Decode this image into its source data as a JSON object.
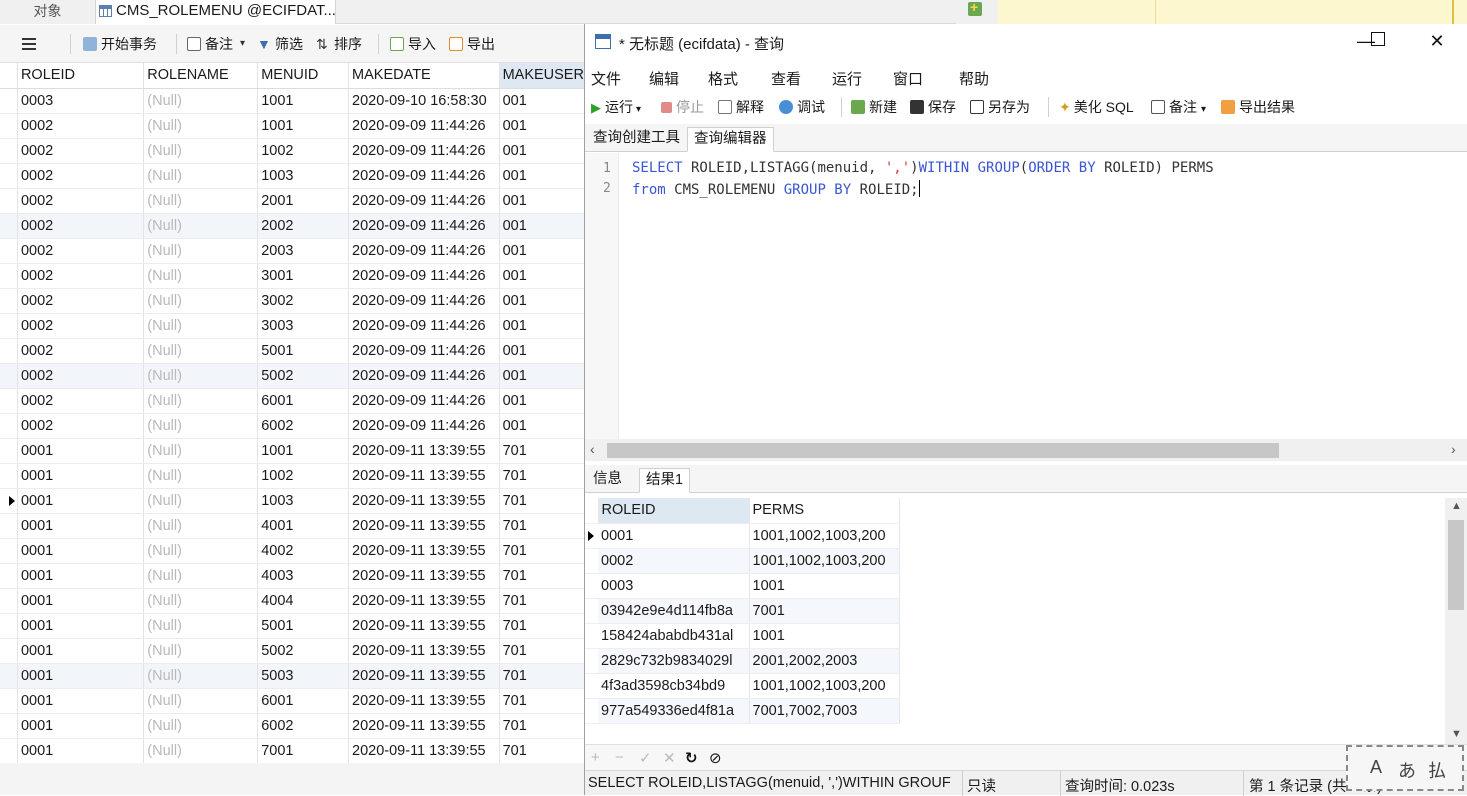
{
  "tabs": {
    "objects": "对象",
    "table_tab": "CMS_ROLEMENU @ECIFDAT..."
  },
  "left_toolbar": {
    "begin_tx": "开始事务",
    "note": "备注",
    "filter": "筛选",
    "sort": "排序",
    "import": "导入",
    "export": "导出"
  },
  "grid": {
    "columns": [
      "ROLEID",
      "ROLENAME",
      "MENUID",
      "MAKEDATE",
      "MAKEUSER"
    ],
    "rows": [
      [
        "0003",
        "(Null)",
        "1001",
        "2020-09-10 16:58:30",
        "001"
      ],
      [
        "0002",
        "(Null)",
        "1001",
        "2020-09-09 11:44:26",
        "001"
      ],
      [
        "0002",
        "(Null)",
        "1002",
        "2020-09-09 11:44:26",
        "001"
      ],
      [
        "0002",
        "(Null)",
        "1003",
        "2020-09-09 11:44:26",
        "001"
      ],
      [
        "0002",
        "(Null)",
        "2001",
        "2020-09-09 11:44:26",
        "001"
      ],
      [
        "0002",
        "(Null)",
        "2002",
        "2020-09-09 11:44:26",
        "001"
      ],
      [
        "0002",
        "(Null)",
        "2003",
        "2020-09-09 11:44:26",
        "001"
      ],
      [
        "0002",
        "(Null)",
        "3001",
        "2020-09-09 11:44:26",
        "001"
      ],
      [
        "0002",
        "(Null)",
        "3002",
        "2020-09-09 11:44:26",
        "001"
      ],
      [
        "0002",
        "(Null)",
        "3003",
        "2020-09-09 11:44:26",
        "001"
      ],
      [
        "0002",
        "(Null)",
        "5001",
        "2020-09-09 11:44:26",
        "001"
      ],
      [
        "0002",
        "(Null)",
        "5002",
        "2020-09-09 11:44:26",
        "001"
      ],
      [
        "0002",
        "(Null)",
        "6001",
        "2020-09-09 11:44:26",
        "001"
      ],
      [
        "0002",
        "(Null)",
        "6002",
        "2020-09-09 11:44:26",
        "001"
      ],
      [
        "0001",
        "(Null)",
        "1001",
        "2020-09-11 13:39:55",
        "701"
      ],
      [
        "0001",
        "(Null)",
        "1002",
        "2020-09-11 13:39:55",
        "701"
      ],
      [
        "0001",
        "(Null)",
        "1003",
        "2020-09-11 13:39:55",
        "701"
      ],
      [
        "0001",
        "(Null)",
        "4001",
        "2020-09-11 13:39:55",
        "701"
      ],
      [
        "0001",
        "(Null)",
        "4002",
        "2020-09-11 13:39:55",
        "701"
      ],
      [
        "0001",
        "(Null)",
        "4003",
        "2020-09-11 13:39:55",
        "701"
      ],
      [
        "0001",
        "(Null)",
        "4004",
        "2020-09-11 13:39:55",
        "701"
      ],
      [
        "0001",
        "(Null)",
        "5001",
        "2020-09-11 13:39:55",
        "701"
      ],
      [
        "0001",
        "(Null)",
        "5002",
        "2020-09-11 13:39:55",
        "701"
      ],
      [
        "0001",
        "(Null)",
        "5003",
        "2020-09-11 13:39:55",
        "701"
      ],
      [
        "0001",
        "(Null)",
        "6001",
        "2020-09-11 13:39:55",
        "701"
      ],
      [
        "0001",
        "(Null)",
        "6002",
        "2020-09-11 13:39:55",
        "701"
      ],
      [
        "0001",
        "(Null)",
        "7001",
        "2020-09-11 13:39:55",
        "701"
      ]
    ],
    "current_row": 16,
    "alt_rows": [
      5,
      11,
      23
    ]
  },
  "query_window": {
    "title": "* 无标题 (ecifdata) - 查询",
    "menu": [
      "文件",
      "编辑",
      "格式",
      "查看",
      "运行",
      "窗口",
      "帮助"
    ],
    "toolbar": {
      "run": "运行",
      "stop": "停止",
      "explain": "解释",
      "debug": "调试",
      "new": "新建",
      "save": "保存",
      "save_as": "另存为",
      "beautify": "美化 SQL",
      "note": "备注",
      "export": "导出结果"
    },
    "tabs": [
      "查询创建工具",
      "查询编辑器"
    ],
    "line_numbers": [
      "1",
      "2"
    ],
    "sql": {
      "l1_a": "SELECT",
      "l1_b": " ROLEID,LISTAGG(menuid, ",
      "l1_c": "','",
      "l1_d": ")",
      "l1_e": "WITHIN GROUP",
      "l1_f": "(",
      "l1_g": "ORDER BY",
      "l1_h": " ROLEID) PERMS",
      "l2_a": "from",
      "l2_b": " CMS_ROLEMENU ",
      "l2_c": "GROUP BY",
      "l2_d": " ROLEID;"
    },
    "result_tabs": [
      "信息",
      "结果1"
    ],
    "result_columns": [
      "ROLEID",
      "PERMS"
    ],
    "result_rows": [
      [
        "0001",
        "1001,1002,1003,200"
      ],
      [
        "0002",
        "1001,1002,1003,200"
      ],
      [
        "0003",
        "1001"
      ],
      [
        "03942e9e4d114fb8a",
        "7001"
      ],
      [
        "158424ababdb431al",
        "1001"
      ],
      [
        "2829c732b9834029l",
        "2001,2002,2003"
      ],
      [
        "4f3ad3598cb34bd9",
        "1001,1002,1003,200"
      ],
      [
        "977a549336ed4f81a",
        "7001,7002,7003"
      ]
    ],
    "status": {
      "sql": "SELECT ROLEID,LISTAGG(menuid, ',')WITHIN GROUF",
      "readonly": "只读",
      "query_time": "查询时间: 0.023s",
      "record": "第 1 条记录 (共 8 条)"
    }
  },
  "ime": {
    "a": "A",
    "b": "あ",
    "c": "払"
  },
  "colors": {
    "keyword": "#3a56d4",
    "string": "#d43a3a",
    "null_text": "#b9b9b9",
    "tab_yellow": "#fdf7cf"
  }
}
